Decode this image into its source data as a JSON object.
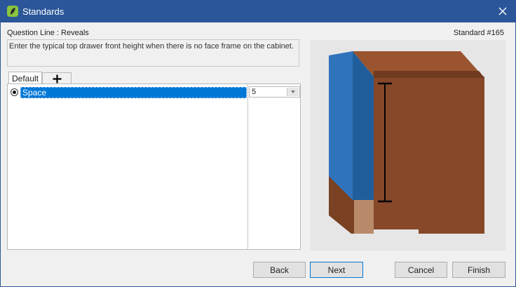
{
  "window": {
    "title": "Standards",
    "icon": "app-logo-icon",
    "close_icon": "close-icon"
  },
  "header": {
    "question_line": "Question Line : Reveals",
    "standard_number": "Standard #165"
  },
  "description": "Enter the typical top drawer front height when there is no face frame on the cabinet.",
  "tabs": [
    {
      "label": "Default",
      "selected": true
    },
    {
      "label": "+",
      "icon": "plus-icon"
    }
  ],
  "list": {
    "rows": [
      {
        "label": "Space",
        "value": "5",
        "selected": true
      }
    ]
  },
  "buttons": {
    "back": "Back",
    "next": "Next",
    "cancel": "Cancel",
    "finish": "Finish"
  },
  "colors": {
    "titlebar": "#2b579a",
    "selection": "#0078d7",
    "cabinet": "#87482a",
    "drawer_front": "#2a6db3"
  }
}
